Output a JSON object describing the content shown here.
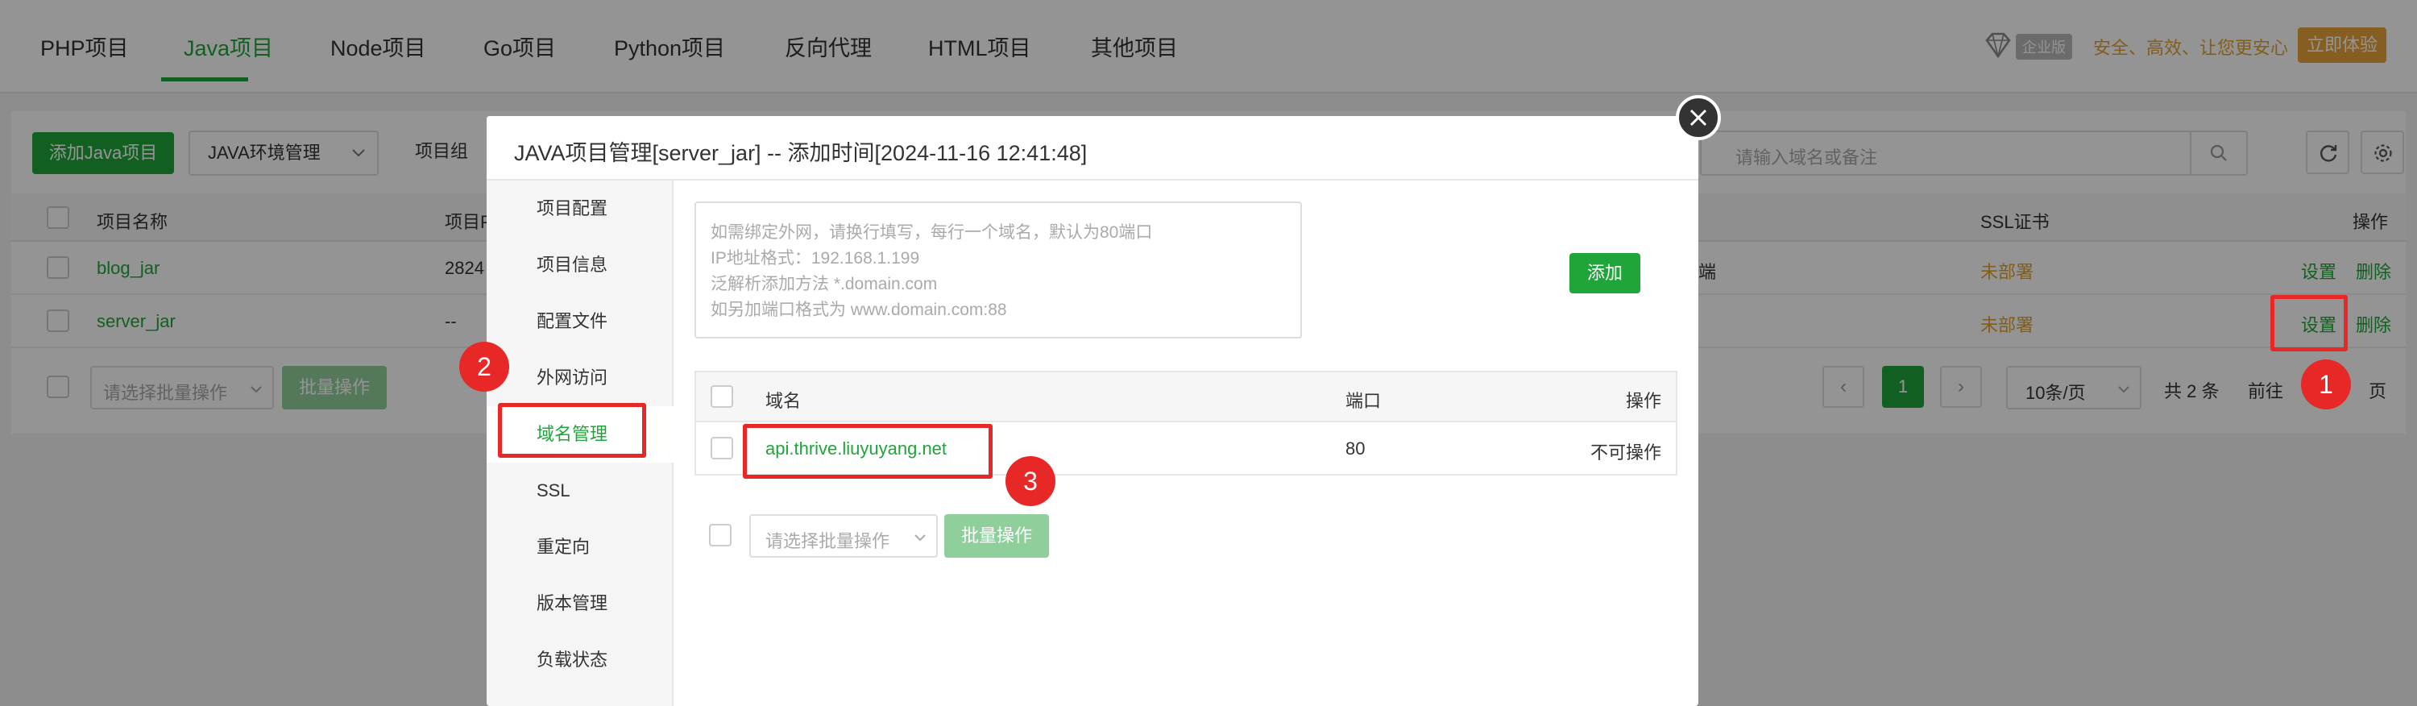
{
  "topnav": {
    "tabs": [
      "PHP项目",
      "Java项目",
      "Node项目",
      "Go项目",
      "Python项目",
      "反向代理",
      "HTML项目",
      "其他项目"
    ],
    "active_tab": "Java项目",
    "promo_badge": "企业版",
    "promo_text": "安全、高效、让您更安心",
    "promo_button": "立即体验"
  },
  "toolbar": {
    "add_button": "添加Java项目",
    "env_manage": "JAVA环境管理",
    "project_group": "项目组",
    "search_placeholder": "请输入域名或备注"
  },
  "table": {
    "headers": {
      "name": "项目名称",
      "pid": "项目P",
      "ssl": "SSL证书",
      "actions": "操作"
    },
    "rows": [
      {
        "name": "blog_jar",
        "pid": "2824",
        "mid": "端",
        "ssl": "未部署",
        "settings": "设置",
        "delete": "删除"
      },
      {
        "name": "server_jar",
        "pid": "--",
        "mid": "",
        "ssl": "未部署",
        "settings": "设置",
        "delete": "删除"
      }
    ]
  },
  "footer": {
    "batch_placeholder": "请选择批量操作",
    "batch_button": "批量操作",
    "prev": "‹",
    "next": "›",
    "current_page": "1",
    "page_size": "10条/页",
    "total": "共 2 条",
    "goto": "前往",
    "page_unit": "页"
  },
  "modal": {
    "title": "JAVA项目管理[server_jar] -- 添加时间[2024-11-16 12:41:48]",
    "close": "×",
    "side_items": [
      "项目配置",
      "项目信息",
      "配置文件",
      "外网访问",
      "域名管理",
      "SSL",
      "重定向",
      "版本管理",
      "负载状态"
    ],
    "active_side": "域名管理",
    "textarea_lines": [
      "如需绑定外网，请换行填写，每行一个域名，默认为80端口",
      "IP地址格式：192.168.1.199",
      "泛解析添加方法 *.domain.com",
      "如另加端口格式为 www.domain.com:88"
    ],
    "add_button": "添加",
    "domain_table": {
      "headers": {
        "domain": "域名",
        "port": "端口",
        "action": "操作"
      },
      "rows": [
        {
          "domain": "api.thrive.liuyuyang.net",
          "port": "80",
          "action": "不可操作"
        }
      ]
    },
    "batch_placeholder": "请选择批量操作",
    "batch_button": "批量操作"
  },
  "annotations": {
    "badge1": "1",
    "badge2": "2",
    "badge3": "3"
  },
  "colors": {
    "accent": "#20a53a",
    "warning": "#e0a030",
    "annotation": "#e82727"
  }
}
